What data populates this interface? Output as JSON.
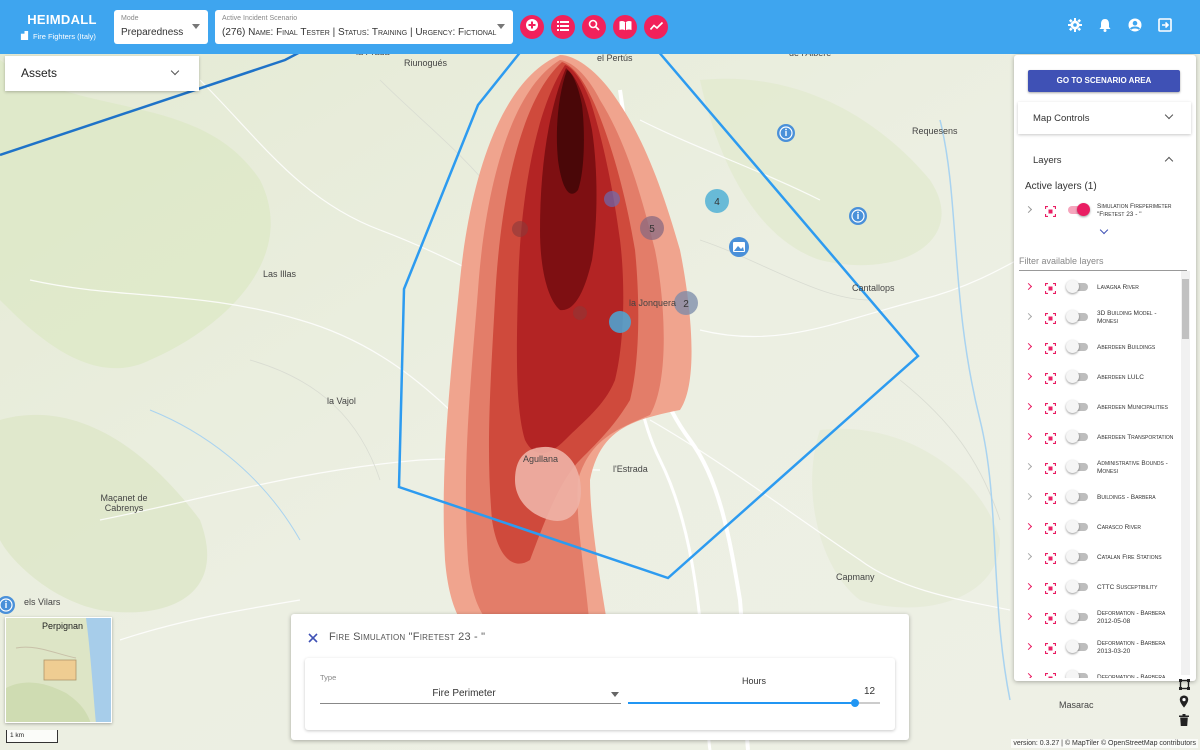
{
  "header": {
    "app_name": "HEIMDALL",
    "organization": "Fire Fighters (Italy)",
    "mode": {
      "label": "Mode",
      "value": "Preparedness"
    },
    "scenario": {
      "label": "Active Incident Scenario",
      "value": "(276) Name: Final Tester | Status: Training | Urgency: Fictional"
    },
    "action_icons": [
      "add-circle-icon",
      "list-icon",
      "search-icon",
      "book-icon",
      "trend-line-icon"
    ],
    "right_icons": [
      "gear-icon",
      "bell-icon",
      "account-icon",
      "logout-icon"
    ],
    "accent": "#f1215b",
    "bar_color": "#3ea5ef"
  },
  "assets": {
    "title": "Assets"
  },
  "panel": {
    "goto_button": "GO TO SCENARIO AREA",
    "map_controls": "Map Controls",
    "layers": "Layers",
    "active_layers_title": "Active layers (1)",
    "active_layers": [
      {
        "name": "Simulation Fireperimeter \"Firetest 23 - \"",
        "enabled": true
      }
    ],
    "filter_placeholder": "Filter available layers",
    "available_layers": [
      {
        "name": "Lavagna River",
        "expandable": true,
        "enabled": false
      },
      {
        "name": "3D Building Model - Monesi",
        "expandable": false,
        "enabled": false
      },
      {
        "name": "Aberdeen Buildings",
        "expandable": true,
        "enabled": false
      },
      {
        "name": "Aberdeen LULC",
        "expandable": true,
        "enabled": false
      },
      {
        "name": "Aberdeen Municipalities",
        "expandable": true,
        "enabled": false
      },
      {
        "name": "Aberdeen Transportation",
        "expandable": true,
        "enabled": false
      },
      {
        "name": "Administrative Bounds - Monesi",
        "expandable": false,
        "enabled": false
      },
      {
        "name": "Buildings - Barbera",
        "expandable": false,
        "enabled": false
      },
      {
        "name": "Carasco River",
        "expandable": true,
        "enabled": false
      },
      {
        "name": "Catalan Fire Stations",
        "expandable": false,
        "enabled": false
      },
      {
        "name": "CTTC Susceptibility",
        "expandable": true,
        "enabled": false
      },
      {
        "name": "Deformation - Barbera 2012-05-08",
        "expandable": true,
        "enabled": false
      },
      {
        "name": "Deformation - Barbera 2013-03-20",
        "expandable": true,
        "enabled": false
      },
      {
        "name": "Deformation - Barbera",
        "expandable": true,
        "enabled": false
      }
    ]
  },
  "map": {
    "places": [
      {
        "name": "el Pertús"
      },
      {
        "name": "la Prada"
      },
      {
        "name": "Riunogués"
      },
      {
        "name": "de l'Albère"
      },
      {
        "name": "Requesens"
      },
      {
        "name": "Las Illas"
      },
      {
        "name": "la Jonquera"
      },
      {
        "name": "Cantallops"
      },
      {
        "name": "la Vajol"
      },
      {
        "name": "Agullana"
      },
      {
        "name": "l'Estrada"
      },
      {
        "name": "Maçanet de Cabrenys"
      },
      {
        "name": "Capmany"
      },
      {
        "name": "els Vilars"
      },
      {
        "name": "Masarac"
      }
    ],
    "cluster_badges": [
      {
        "count": "4"
      },
      {
        "count": "5"
      },
      {
        "count": "2"
      }
    ],
    "map_tools": [
      "bounding-box-icon",
      "location-pin-icon",
      "trash-icon"
    ]
  },
  "fire_sim": {
    "title": "Fire Simulation \"Firetest 23 - \"",
    "type_label": "Type",
    "type_value": "Fire Perimeter",
    "hours_label": "Hours",
    "hours_value": "12",
    "hours_max": 12
  },
  "minimap": {
    "label": "Perpignan"
  },
  "scale": {
    "label": "1 km"
  },
  "attribution": "version: 0.3.27 | © MapTiler © OpenStreetMap contributors"
}
